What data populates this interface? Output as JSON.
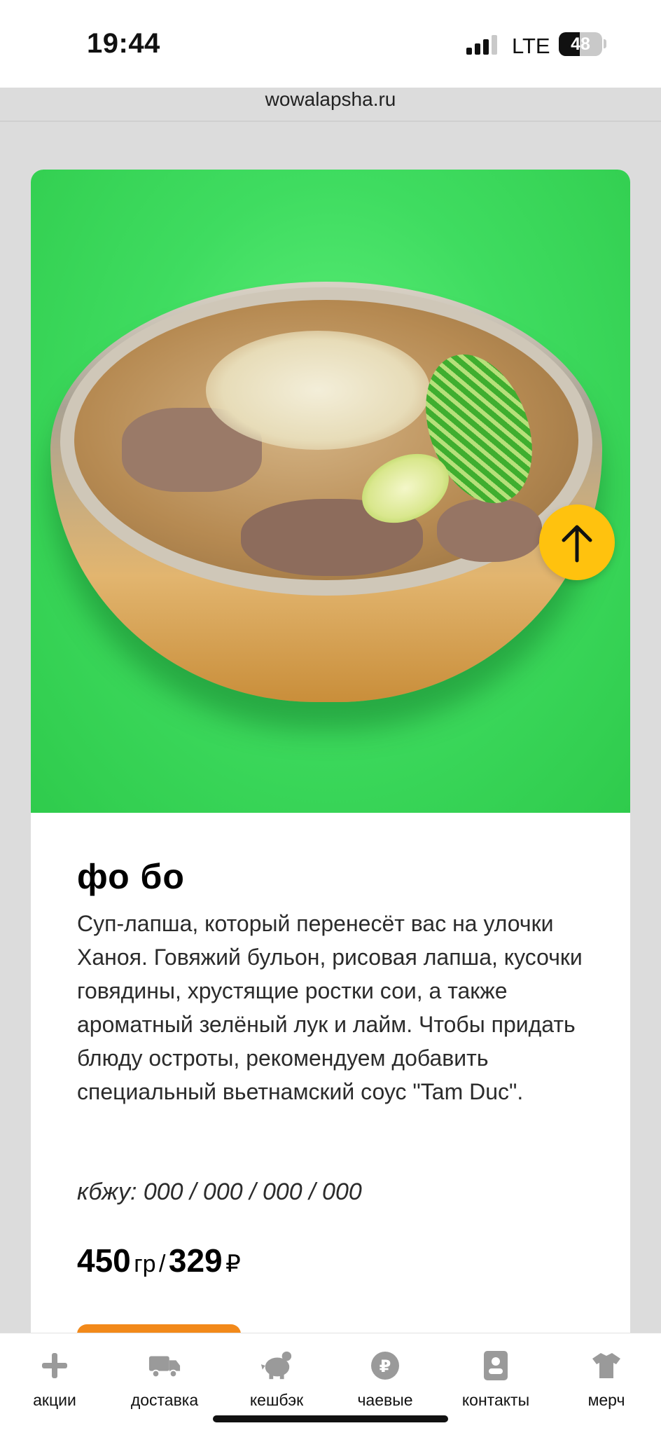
{
  "status_bar": {
    "time": "19:44",
    "network": "LTE",
    "battery": "48",
    "battery_level": 0.48
  },
  "browser": {
    "url": "wowalapsha.ru"
  },
  "product": {
    "title": "фо бо",
    "description": "Суп-лапша, который перенесёт вас на улочки Ханоя. Говяжий бульон, рисовая лапша, кусочки говядины, хрустящие ростки сои, а также ароматный зелёный лук и лайм. Чтобы придать блюду остроты, рекомендуем добавить специальный вьетнамский соус \"Tam Duc\".",
    "kbju": "кбжу: 000 / 000 / 000 / 000",
    "weight": "450",
    "weight_unit": "гр",
    "separator": "/",
    "price": "329",
    "currency": "₽"
  },
  "nav": {
    "items": [
      {
        "label": "акции",
        "icon": "plus-icon"
      },
      {
        "label": "доставка",
        "icon": "truck-icon"
      },
      {
        "label": "кешбэк",
        "icon": "piggy-bank-icon"
      },
      {
        "label": "чаевые",
        "icon": "ruble-coin-icon"
      },
      {
        "label": "контакты",
        "icon": "contact-card-icon"
      },
      {
        "label": "мерч",
        "icon": "tshirt-icon"
      }
    ]
  },
  "colors": {
    "accent_yellow": "#ffc20e",
    "photo_green": "#3fdc60",
    "order_orange": "#f2891a",
    "nav_icon_gray": "#9a9a9a"
  }
}
